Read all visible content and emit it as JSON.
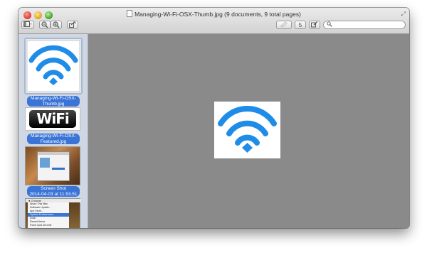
{
  "window": {
    "title": "Managing-Wi-Fi-OSX-Thumb.jpg (9 documents, 9 total pages)"
  },
  "toolbar": {
    "sidebar_toggle_icon": "sidebar-icon",
    "zoom_out_icon": "zoom-out-icon",
    "zoom_in_icon": "zoom-in-icon",
    "share_icon": "share-icon",
    "pen_icon": "pen-icon",
    "rotate_label": "5",
    "edit_icon": "edit-icon",
    "search_icon": "magnifier-icon"
  },
  "sidebar": {
    "items": [
      {
        "caption_line1": "Managing-Wi-Fi-OSX-",
        "caption_line2": "Thumb.jpg"
      },
      {
        "caption_line1": "Managing-Wi-Fi-OSX-",
        "caption_line2": "Featured.jpg",
        "logo_text": "WiFi"
      },
      {
        "caption_line1": "Screen Shot",
        "caption_line2": "2014-04-03 at 11.53.51"
      },
      {
        "menu_title": "Chrome",
        "menu_items": [
          "About This Mac",
          "Software Update...",
          "App Store...",
          "System Preferences...",
          "Dock",
          "Recent Items",
          "Force Quit Chrome"
        ]
      }
    ]
  },
  "colors": {
    "selection": "#3a74d6",
    "wifi_blue": "#1f8de8"
  }
}
